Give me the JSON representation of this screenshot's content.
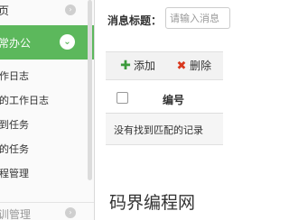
{
  "sidebar": {
    "top_item": {
      "label": "页",
      "icon": "circle-right-icon"
    },
    "active_group": {
      "label": "常办公",
      "icon": "chevron-down-icon"
    },
    "items": [
      {
        "label": "作日志"
      },
      {
        "label": "的工作日志"
      },
      {
        "label": "到任务"
      },
      {
        "label": "的任务"
      },
      {
        "label": "程管理"
      }
    ],
    "bottom_item": {
      "label": "训管理",
      "icon": "circle-right-icon"
    }
  },
  "main": {
    "search": {
      "label": "消息标题：",
      "placeholder": "请输入消息"
    },
    "toolbar": {
      "add_label": "添加",
      "add_icon": "plus-icon",
      "delete_label": "删除",
      "delete_icon": "x-icon"
    },
    "table": {
      "columns": [
        "编号"
      ],
      "empty_text": "没有找到匹配的记录"
    }
  },
  "watermark": "码界编程网",
  "colors": {
    "accent": "#5cb85c",
    "add_icon": "#3c9a3c",
    "delete_icon": "#d9381e"
  }
}
